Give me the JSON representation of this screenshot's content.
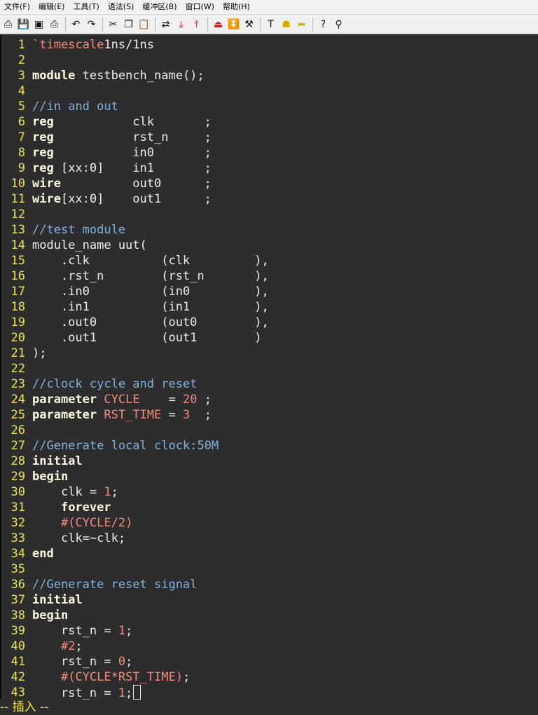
{
  "menubar": {
    "items": [
      "文件(F)",
      "编辑(E)",
      "工具(T)",
      "语法(S)",
      "缓冲区(B)",
      "窗口(W)",
      "帮助(H)"
    ]
  },
  "toolbar": {
    "buttons": [
      {
        "name": "open-icon",
        "glyph": "⎙"
      },
      {
        "name": "save-icon",
        "glyph": "💾"
      },
      {
        "name": "save-all-icon",
        "glyph": "▣"
      },
      {
        "name": "print-icon",
        "glyph": "⎙"
      },
      {
        "sep": true
      },
      {
        "name": "undo-icon",
        "glyph": "↶"
      },
      {
        "name": "redo-icon",
        "glyph": "↷"
      },
      {
        "sep": true
      },
      {
        "name": "cut-icon",
        "glyph": "✂"
      },
      {
        "name": "copy-icon",
        "glyph": "❐"
      },
      {
        "name": "paste-icon",
        "glyph": "📋"
      },
      {
        "sep": true
      },
      {
        "name": "replace-icon",
        "glyph": "⇄"
      },
      {
        "name": "find-next-icon",
        "glyph": "⤓",
        "red": true
      },
      {
        "name": "find-prev-icon",
        "glyph": "⤒",
        "red": true
      },
      {
        "sep": true
      },
      {
        "name": "load-session-icon",
        "glyph": "⏏",
        "red": true
      },
      {
        "name": "save-session-icon",
        "glyph": "⏬",
        "red": true
      },
      {
        "name": "run-script-icon",
        "glyph": "⚒"
      },
      {
        "sep": true
      },
      {
        "name": "make-icon",
        "glyph": "T"
      },
      {
        "name": "shell-icon",
        "glyph": "☗",
        "yellow": true
      },
      {
        "name": "tag-jump-icon",
        "glyph": "⬅",
        "yellow": true
      },
      {
        "sep": true
      },
      {
        "name": "help-icon",
        "glyph": "?"
      },
      {
        "name": "find-help-icon",
        "glyph": "⚲"
      }
    ]
  },
  "editor": {
    "lines": [
      {
        "n": "1",
        "t": [
          [
            "pp",
            "`timescale"
          ],
          [
            "",
            "1ns/1ns"
          ]
        ]
      },
      {
        "n": "2",
        "t": []
      },
      {
        "n": "3",
        "t": [
          [
            "kw",
            "module"
          ],
          [
            "",
            " testbench_name();"
          ]
        ]
      },
      {
        "n": "4",
        "t": []
      },
      {
        "n": "5",
        "t": [
          [
            "cm",
            "//in and out"
          ]
        ]
      },
      {
        "n": "6",
        "t": [
          [
            "kw",
            "reg"
          ],
          [
            "",
            "           clk       ;"
          ]
        ]
      },
      {
        "n": "7",
        "t": [
          [
            "kw",
            "reg"
          ],
          [
            "",
            "           rst_n     ;"
          ]
        ]
      },
      {
        "n": "8",
        "t": [
          [
            "kw",
            "reg"
          ],
          [
            "",
            "           in0       ;"
          ]
        ]
      },
      {
        "n": "9",
        "t": [
          [
            "kw",
            "reg"
          ],
          [
            "",
            " [xx:0]    in1       ;"
          ]
        ]
      },
      {
        "n": "10",
        "t": [
          [
            "kw",
            "wire"
          ],
          [
            "",
            "          out0      ;"
          ]
        ]
      },
      {
        "n": "11",
        "t": [
          [
            "kw",
            "wire"
          ],
          [
            "",
            "[xx:0]    out1      ;"
          ]
        ]
      },
      {
        "n": "12",
        "t": []
      },
      {
        "n": "13",
        "t": [
          [
            "cm",
            "//test module"
          ]
        ]
      },
      {
        "n": "14",
        "t": [
          [
            "",
            "module_name uut("
          ]
        ]
      },
      {
        "n": "15",
        "t": [
          [
            "",
            "    .clk          (clk         ),"
          ]
        ]
      },
      {
        "n": "16",
        "t": [
          [
            "",
            "    .rst_n        (rst_n       ),"
          ]
        ]
      },
      {
        "n": "17",
        "t": [
          [
            "",
            "    .in0          (in0         ),"
          ]
        ]
      },
      {
        "n": "18",
        "t": [
          [
            "",
            "    .in1          (in1         ),"
          ]
        ]
      },
      {
        "n": "19",
        "t": [
          [
            "",
            "    .out0         (out0        ),"
          ]
        ]
      },
      {
        "n": "20",
        "t": [
          [
            "",
            "    .out1         (out1        )"
          ]
        ]
      },
      {
        "n": "21",
        "t": [
          [
            "",
            ");"
          ]
        ]
      },
      {
        "n": "22",
        "t": []
      },
      {
        "n": "23",
        "t": [
          [
            "cm",
            "//clock cycle and reset"
          ]
        ]
      },
      {
        "n": "24",
        "t": [
          [
            "kw",
            "parameter"
          ],
          [
            "",
            " "
          ],
          [
            "nm",
            "CYCLE"
          ],
          [
            "",
            "    = "
          ],
          [
            "nm",
            "20"
          ],
          [
            "",
            " ;"
          ]
        ]
      },
      {
        "n": "25",
        "t": [
          [
            "kw",
            "parameter"
          ],
          [
            "",
            " "
          ],
          [
            "nm",
            "RST_TIME"
          ],
          [
            "",
            " = "
          ],
          [
            "nm",
            "3"
          ],
          [
            "",
            "  ;"
          ]
        ]
      },
      {
        "n": "26",
        "t": []
      },
      {
        "n": "27",
        "t": [
          [
            "cm",
            "//Generate local clock:50M"
          ]
        ]
      },
      {
        "n": "28",
        "t": [
          [
            "kw",
            "initial"
          ]
        ]
      },
      {
        "n": "29",
        "t": [
          [
            "kw",
            "begin"
          ]
        ]
      },
      {
        "n": "30",
        "t": [
          [
            "",
            "    clk = "
          ],
          [
            "nm",
            "1"
          ],
          [
            "",
            ";"
          ]
        ]
      },
      {
        "n": "31",
        "t": [
          [
            "",
            "    "
          ],
          [
            "kw",
            "forever"
          ]
        ]
      },
      {
        "n": "32",
        "t": [
          [
            "",
            "    "
          ],
          [
            "nm",
            "#(CYCLE/2)"
          ]
        ]
      },
      {
        "n": "33",
        "t": [
          [
            "",
            "    clk=~clk;"
          ]
        ]
      },
      {
        "n": "34",
        "t": [
          [
            "kw",
            "end"
          ]
        ]
      },
      {
        "n": "35",
        "t": []
      },
      {
        "n": "36",
        "t": [
          [
            "cm",
            "//Generate reset signal"
          ]
        ]
      },
      {
        "n": "37",
        "t": [
          [
            "kw",
            "initial"
          ]
        ]
      },
      {
        "n": "38",
        "t": [
          [
            "kw",
            "begin"
          ]
        ]
      },
      {
        "n": "39",
        "t": [
          [
            "",
            "    rst_n = "
          ],
          [
            "nm",
            "1"
          ],
          [
            "",
            ";"
          ]
        ]
      },
      {
        "n": "40",
        "t": [
          [
            "",
            "    "
          ],
          [
            "nm",
            "#2"
          ],
          [
            "",
            ";"
          ]
        ]
      },
      {
        "n": "41",
        "t": [
          [
            "",
            "    rst_n = "
          ],
          [
            "nm",
            "0"
          ],
          [
            "",
            ";"
          ]
        ]
      },
      {
        "n": "42",
        "t": [
          [
            "",
            "    "
          ],
          [
            "nm",
            "#(CYCLE*RST_TIME)"
          ],
          [
            "",
            ";"
          ]
        ]
      },
      {
        "n": "43",
        "t": [
          [
            "",
            "    rst_n = "
          ],
          [
            "nm",
            "1"
          ],
          [
            "",
            ";"
          ]
        ],
        "cursor": true
      }
    ]
  },
  "statusbar": {
    "mode": "-- 插入 --"
  }
}
